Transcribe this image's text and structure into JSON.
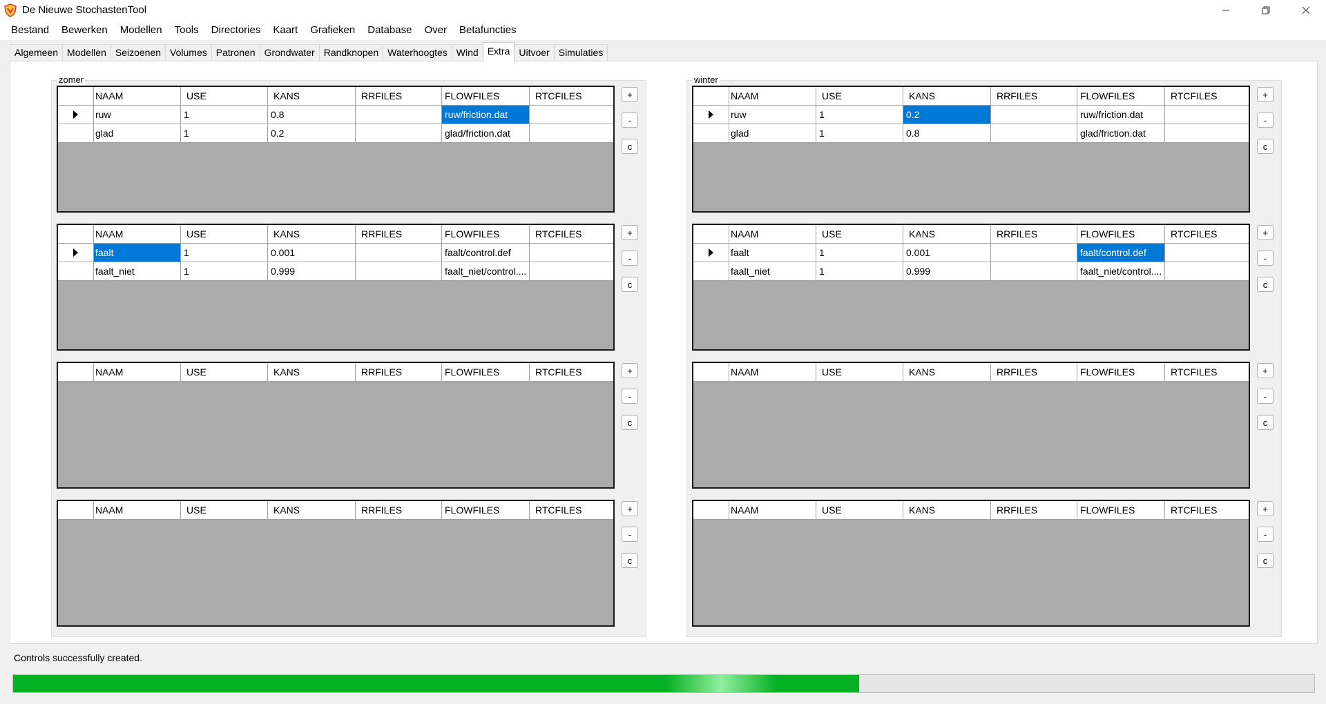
{
  "window": {
    "title": "De Nieuwe StochastenTool"
  },
  "menu": [
    "Bestand",
    "Bewerken",
    "Modellen",
    "Tools",
    "Directories",
    "Kaart",
    "Grafieken",
    "Database",
    "Over",
    "Betafuncties"
  ],
  "tabs": [
    "Algemeen",
    "Modellen",
    "Seizoenen",
    "Volumes",
    "Patronen",
    "Grondwater",
    "Randknopen",
    "Waterhoogtes",
    "Wind",
    "Extra",
    "Uitvoer",
    "Simulaties"
  ],
  "active_tab": "Extra",
  "columns": [
    "NAAM",
    "USE",
    "KANS",
    "RRFILES",
    "FLOWFILES",
    "RTCFILES"
  ],
  "side_buttons": {
    "add": "+",
    "remove": "-",
    "copy": "c"
  },
  "groups": [
    {
      "caption": "zomer",
      "grids": [
        {
          "rows": [
            {
              "naam": "ruw",
              "use": "1",
              "kans": "0.8",
              "rrfiles": "",
              "flowfiles": "ruw/friction.dat",
              "rtcfiles": ""
            },
            {
              "naam": "glad",
              "use": "1",
              "kans": "0.2",
              "rrfiles": "",
              "flowfiles": "glad/friction.dat",
              "rtcfiles": ""
            }
          ],
          "selected": {
            "row": 0,
            "col": "flowfiles"
          }
        },
        {
          "rows": [
            {
              "naam": "faalt",
              "use": "1",
              "kans": "0.001",
              "rrfiles": "",
              "flowfiles": "faalt/control.def",
              "rtcfiles": ""
            },
            {
              "naam": "faalt_niet",
              "use": "1",
              "kans": "0.999",
              "rrfiles": "",
              "flowfiles": "faalt_niet/control....",
              "rtcfiles": ""
            }
          ],
          "selected": {
            "row": 0,
            "col": "naam"
          }
        },
        {
          "rows": [],
          "selected": null
        },
        {
          "rows": [],
          "selected": null
        }
      ]
    },
    {
      "caption": "winter",
      "grids": [
        {
          "rows": [
            {
              "naam": "ruw",
              "use": "1",
              "kans": "0.2",
              "rrfiles": "",
              "flowfiles": "ruw/friction.dat",
              "rtcfiles": ""
            },
            {
              "naam": "glad",
              "use": "1",
              "kans": "0.8",
              "rrfiles": "",
              "flowfiles": "glad/friction.dat",
              "rtcfiles": ""
            }
          ],
          "selected": {
            "row": 0,
            "col": "kans"
          }
        },
        {
          "rows": [
            {
              "naam": "faalt",
              "use": "1",
              "kans": "0.001",
              "rrfiles": "",
              "flowfiles": "faalt/control.def",
              "rtcfiles": ""
            },
            {
              "naam": "faalt_niet",
              "use": "1",
              "kans": "0.999",
              "rrfiles": "",
              "flowfiles": "faalt_niet/control....",
              "rtcfiles": ""
            }
          ],
          "selected": {
            "row": 0,
            "col": "flowfiles"
          }
        },
        {
          "rows": [],
          "selected": null
        },
        {
          "rows": [],
          "selected": null
        }
      ]
    }
  ],
  "status": {
    "message": "Controls successfully created.",
    "progress_percent": 65
  },
  "colors": {
    "selection": "#0078d7",
    "progress": "#06b025",
    "grid_empty": "#ababab"
  }
}
